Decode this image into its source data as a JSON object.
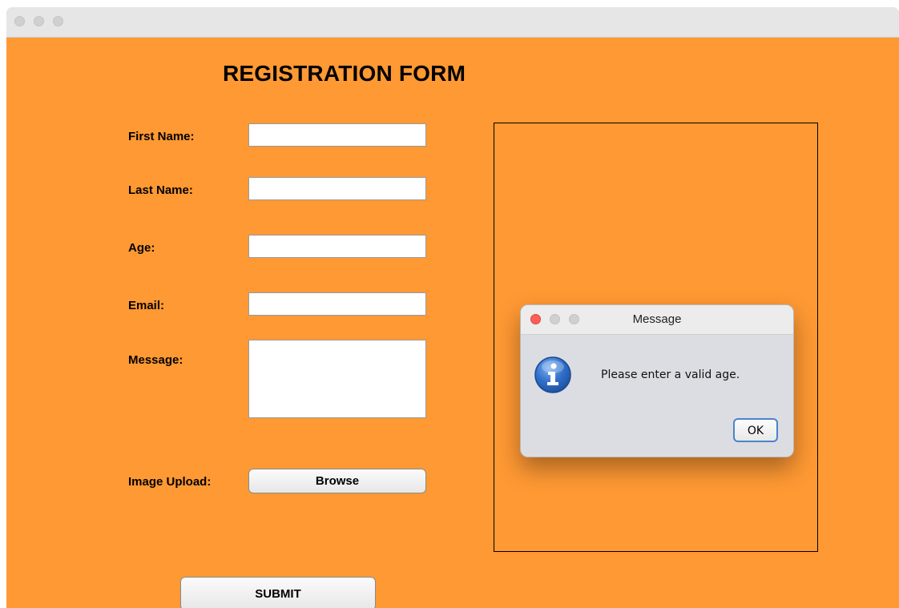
{
  "window": {
    "title": ""
  },
  "form": {
    "heading": "REGISTRATION FORM",
    "first_name_label": "First Name:",
    "last_name_label": "Last Name:",
    "age_label": "Age:",
    "email_label": "Email:",
    "message_label": "Message:",
    "image_upload_label": "Image Upload:",
    "first_name_value": "",
    "last_name_value": "",
    "age_value": "",
    "email_value": "",
    "message_value": "",
    "browse_label": "Browse",
    "submit_label": "SUBMIT"
  },
  "dialog": {
    "title": "Message",
    "message": "Please enter a valid age.",
    "ok_label": "OK",
    "icon": "info-icon"
  },
  "colors": {
    "background": "#ff9933",
    "dialog_close": "#ff5f57",
    "ok_border": "#4a84c9"
  }
}
